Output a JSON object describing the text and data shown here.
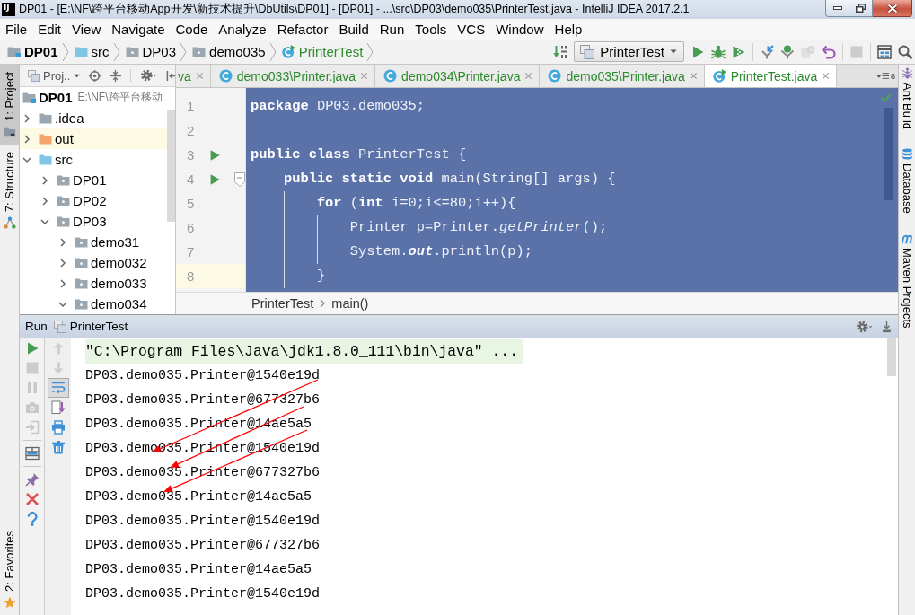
{
  "window": {
    "logo": "IJ",
    "title": "DP01 - [E:\\NF\\跨平台移动App开发\\新技术提升\\DbUtils\\DP01] - [DP01] - ...\\src\\DP03\\demo035\\PrinterTest.java - IntelliJ IDEA 2017.2.1"
  },
  "menu": [
    "File",
    "Edit",
    "View",
    "Navigate",
    "Code",
    "Analyze",
    "Refactor",
    "Build",
    "Run",
    "Tools",
    "VCS",
    "Window",
    "Help"
  ],
  "nav_bar": {
    "crumbs": [
      {
        "label": "DP01",
        "kind": "module"
      },
      {
        "label": "src",
        "kind": "source"
      },
      {
        "label": "DP03",
        "kind": "package"
      },
      {
        "label": "demo035",
        "kind": "package"
      },
      {
        "label": "PrinterTest",
        "kind": "runnable-class"
      }
    ],
    "run_config": "PrinterTest",
    "toolbar": [
      {
        "disabled": false
      },
      {
        "disabled": false
      },
      {
        "disabled": false
      },
      {
        "disabled": false
      },
      {
        "disabled": false
      },
      {
        "disabled": false
      },
      {
        "disabled": true
      },
      {
        "disabled": false
      },
      {
        "disabled": true
      },
      {
        "disabled": false
      },
      {
        "disabled": false
      }
    ]
  },
  "left_tool_stripe": {
    "top": [
      {
        "label": "1: Project",
        "selected": true
      },
      {
        "label": "7: Structure",
        "selected": false
      }
    ],
    "bottom": [
      {
        "label": "2: Favorites",
        "selected": false
      }
    ]
  },
  "project_panel": {
    "view": "Proj..",
    "tree": [
      {
        "label": "DP01",
        "path": "E:\\NF\\跨平台移动",
        "kind": "module",
        "children": [
          {
            "label": ".idea",
            "kind": "folder",
            "expanded": false
          },
          {
            "label": "out",
            "kind": "excluded",
            "expanded": false
          },
          {
            "label": "src",
            "kind": "source",
            "expanded": true,
            "children": [
              {
                "label": "DP01",
                "kind": "package",
                "expanded": false
              },
              {
                "label": "DP02",
                "kind": "package",
                "expanded": false
              },
              {
                "label": "DP03",
                "kind": "package",
                "expanded": true,
                "children": [
                  {
                    "label": "demo31",
                    "kind": "package",
                    "expanded": false
                  },
                  {
                    "label": "demo032",
                    "kind": "package",
                    "expanded": false
                  },
                  {
                    "label": "demo033",
                    "kind": "package",
                    "expanded": false
                  },
                  {
                    "label": "demo034",
                    "kind": "package",
                    "expanded": true
                  }
                ]
              }
            ]
          }
        ]
      }
    ]
  },
  "editor": {
    "tabs": [
      {
        "label": "va",
        "kind": "partial",
        "selected": false
      },
      {
        "label": "demo033\\Printer.java",
        "kind": "class",
        "selected": false
      },
      {
        "label": "demo034\\Printer.java",
        "kind": "class",
        "selected": false
      },
      {
        "label": "demo035\\Printer.java",
        "kind": "class",
        "selected": false
      },
      {
        "label": "PrinterTest.java",
        "kind": "runnable-class",
        "selected": true
      }
    ],
    "hidden_tab_count": "6",
    "lines": [
      {
        "number": "1",
        "selected": true,
        "current": false,
        "run_marker": false,
        "fold_marker": false,
        "tokens": [
          {
            "text": "package",
            "kind": "keyword"
          },
          {
            "text": " DP03.demo035;",
            "kind": "plain"
          }
        ]
      },
      {
        "number": "2",
        "selected": true,
        "current": false,
        "run_marker": false,
        "fold_marker": false
      },
      {
        "number": "3",
        "selected": true,
        "current": false,
        "run_marker": true,
        "fold_marker": false,
        "tokens": [
          {
            "text": "public class",
            "kind": "keyword"
          },
          {
            "text": " PrinterTest {",
            "kind": "plain"
          }
        ]
      },
      {
        "number": "4",
        "selected": true,
        "current": false,
        "run_marker": true,
        "fold_marker": true,
        "tokens": [
          {
            "text": "    public static void",
            "kind": "keyword"
          },
          {
            "text": " main(String[] args) {",
            "kind": "plain"
          }
        ]
      },
      {
        "number": "5",
        "selected": true,
        "current": false,
        "run_marker": false,
        "fold_marker": false,
        "tokens": [
          {
            "text": "        for",
            "kind": "keyword"
          },
          {
            "text": " (",
            "kind": "plain"
          },
          {
            "text": "int",
            "kind": "keyword"
          },
          {
            "text": " i=0;i<=80;i++){",
            "kind": "plain"
          }
        ]
      },
      {
        "number": "6",
        "selected": true,
        "current": false,
        "run_marker": false,
        "fold_marker": false,
        "tokens": [
          {
            "text": "            Printer p=Printer.",
            "kind": "plain"
          },
          {
            "text": "getPrinter",
            "kind": "method"
          },
          {
            "text": "();",
            "kind": "plain"
          }
        ]
      },
      {
        "number": "7",
        "selected": true,
        "current": false,
        "run_marker": false,
        "fold_marker": false,
        "tokens": [
          {
            "text": "            System.",
            "kind": "plain"
          },
          {
            "text": "out",
            "kind": "static"
          },
          {
            "text": ".println(p);",
            "kind": "plain"
          }
        ]
      },
      {
        "number": "8",
        "selected": true,
        "current": true,
        "run_marker": false,
        "fold_marker": false,
        "tokens": [
          {
            "text": "        }",
            "kind": "plain"
          }
        ]
      }
    ],
    "breadcrumbs": [
      "PrinterTest",
      "main()"
    ]
  },
  "right_tool_stripe": [
    {
      "label": "Ant Build",
      "selected": false
    },
    {
      "label": "Database",
      "selected": false
    },
    {
      "label": "Maven Projects",
      "selected": false
    }
  ],
  "run_panel": {
    "title": "Run",
    "tab": "PrinterTest",
    "left_toolbar": [
      {
        "disabled": false
      },
      {
        "disabled": true
      },
      {
        "disabled": true
      },
      {
        "disabled": true
      },
      {
        "disabled": true
      },
      {
        "disabled": false
      },
      {
        "disabled": false
      },
      {
        "disabled": false
      },
      {
        "disabled": false
      }
    ],
    "console_toolbar": [
      {
        "disabled": true,
        "on": false
      },
      {
        "disabled": true,
        "on": false
      },
      {
        "disabled": false,
        "on": true
      },
      {
        "disabled": false,
        "on": false
      },
      {
        "disabled": false,
        "on": false
      },
      {
        "disabled": false,
        "on": false
      }
    ],
    "console": {
      "command": "\"C:\\Program Files\\Java\\jdk1.8.0_111\\bin\\java\" ...",
      "lines": [
        "DP03.demo035.Printer@1540e19d",
        "DP03.demo035.Printer@677327b6",
        "DP03.demo035.Printer@14ae5a5",
        "DP03.demo035.Printer@1540e19d",
        "DP03.demo035.Printer@677327b6",
        "DP03.demo035.Printer@14ae5a5",
        "DP03.demo035.Printer@1540e19d",
        "DP03.demo035.Printer@677327b6",
        "DP03.demo035.Printer@14ae5a5",
        "DP03.demo035.Printer@1540e19d"
      ],
      "annotation_arrows": true
    }
  }
}
